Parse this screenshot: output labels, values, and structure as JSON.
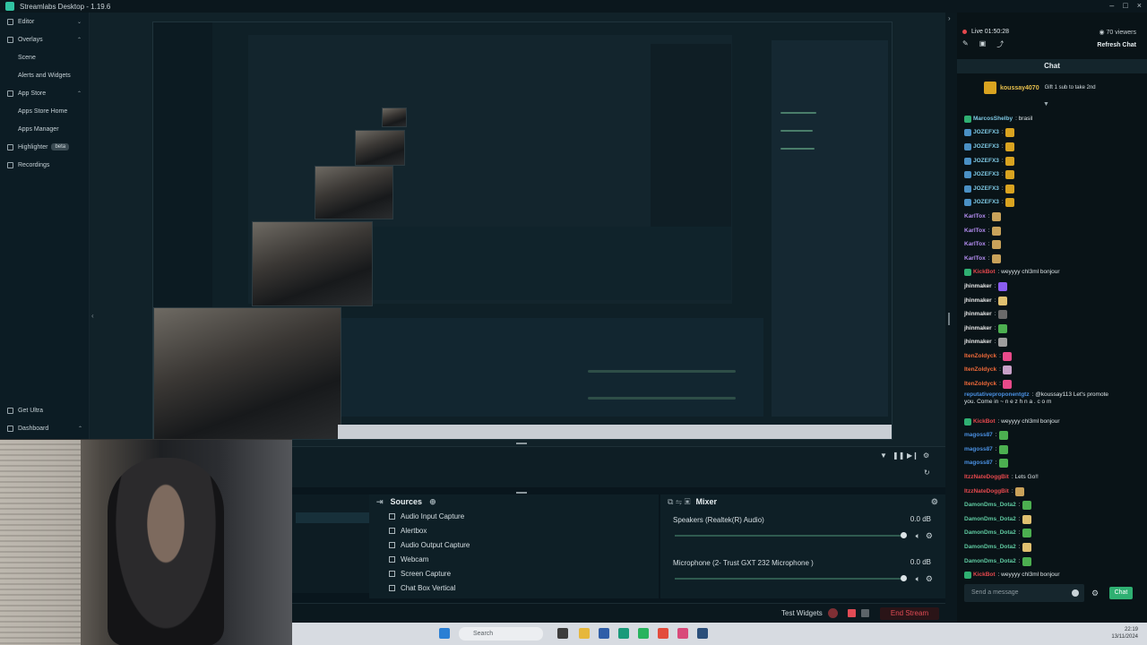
{
  "app": {
    "title": "Streamlabs Desktop - 1.19.6",
    "window_controls": [
      "–",
      "□",
      "×"
    ]
  },
  "sidebar": {
    "items": [
      {
        "label": "Editor",
        "icon": "editor-icon",
        "chevron": "⌄"
      },
      {
        "label": "Overlays",
        "icon": "overlays-icon",
        "chevron": "⌃"
      },
      {
        "label": "Scene",
        "sub": true
      },
      {
        "label": "Alerts and Widgets",
        "sub": true
      },
      {
        "label": "App Store",
        "icon": "store-icon",
        "chevron": "⌃"
      },
      {
        "label": "Apps Store Home",
        "sub": true
      },
      {
        "label": "Apps Manager",
        "sub": true
      },
      {
        "label": "Highlighter",
        "icon": "highlighter-icon",
        "badge": "beta"
      },
      {
        "label": "Recordings",
        "icon": "recordings-icon"
      }
    ],
    "bottom": [
      {
        "label": "Get Ultra",
        "icon": "ultra-icon"
      },
      {
        "label": "Dashboard",
        "icon": "dashboard-icon",
        "chevron": "⌃"
      }
    ]
  },
  "studio": {
    "sources_title": "Sources",
    "sources": [
      "Audio Input Capture",
      "Alertbox",
      "Audio Output Capture",
      "Webcam",
      "Screen Capture",
      "Chat Box Vertical"
    ],
    "mixer_title": "Mixer",
    "mixer": [
      {
        "name": "Speakers (Realtek(R) Audio)",
        "db": "0.0 dB",
        "level": 1.0
      },
      {
        "name": "Microphone (2- Trust GXT 232 Microphone )",
        "db": "0.0 dB",
        "level": 1.0
      }
    ],
    "test_widgets": "Test Widgets",
    "end_stream": "End Stream"
  },
  "chat": {
    "live": "Live 01:50:28",
    "viewers": "70 viewers",
    "refresh": "Refresh Chat",
    "header": "Chat",
    "sub_banner": {
      "user": "koussay4070",
      "text": "Gift 1 sub to take 2nd"
    },
    "messages": [
      {
        "name": "MarcosShelby",
        "color": "#7ec8e3",
        "text": ": brasil",
        "emblem": "#2fb072"
      },
      {
        "name": "JOZEFX3",
        "color": "#7ec8e3",
        "text": ":",
        "emblem": "#4a90c4",
        "emote": "#d9a320"
      },
      {
        "name": "JOZEFX3",
        "color": "#7ec8e3",
        "text": ":",
        "emblem": "#4a90c4",
        "emote": "#d9a320"
      },
      {
        "name": "JOZEFX3",
        "color": "#7ec8e3",
        "text": ":",
        "emblem": "#4a90c4",
        "emote": "#d9a320"
      },
      {
        "name": "JOZEFX3",
        "color": "#7ec8e3",
        "text": ":",
        "emblem": "#4a90c4",
        "emote": "#d9a320"
      },
      {
        "name": "JOZEFX3",
        "color": "#7ec8e3",
        "text": ":",
        "emblem": "#4a90c4",
        "emote": "#d9a320"
      },
      {
        "name": "JOZEFX3",
        "color": "#7ec8e3",
        "text": ":",
        "emblem": "#4a90c4",
        "emote": "#d9a320"
      },
      {
        "name": "KarlTox",
        "color": "#b38cf0",
        "text": ":",
        "emote": "#c9a25a"
      },
      {
        "name": "KarlTox",
        "color": "#b38cf0",
        "text": ":",
        "emote": "#c9a25a"
      },
      {
        "name": "KarlTox",
        "color": "#b38cf0",
        "text": ":",
        "emote": "#c9a25a"
      },
      {
        "name": "KarlTox",
        "color": "#b38cf0",
        "text": ":",
        "emote": "#c9a25a"
      },
      {
        "name": "KickBot",
        "color": "#e5484d",
        "text": ": weyyyy chl3ml bonjour",
        "emblem": "#2fb072"
      },
      {
        "name": "jhinmaker",
        "color": "#e6e6e6",
        "text": ":",
        "emote": "#8a5cf0"
      },
      {
        "name": "jhinmaker",
        "color": "#e6e6e6",
        "text": ":",
        "emote": "#e0c070"
      },
      {
        "name": "jhinmaker",
        "color": "#e6e6e6",
        "text": ":",
        "emote": "#6a6a6a"
      },
      {
        "name": "jhinmaker",
        "color": "#e6e6e6",
        "text": ":",
        "emote": "#4caf50"
      },
      {
        "name": "jhinmaker",
        "color": "#e6e6e6",
        "text": ":",
        "emote": "#9e9e9e"
      },
      {
        "name": "ItenZoldyck",
        "color": "#f06a3a",
        "text": ":",
        "emote": "#e84a8a"
      },
      {
        "name": "ItenZoldyck",
        "color": "#f06a3a",
        "text": ":",
        "emote": "#c8a0c8"
      },
      {
        "name": "ItenZoldyck",
        "color": "#f06a3a",
        "text": ":",
        "emote": "#e84a8a"
      },
      {
        "name": "reputativeproponentgtz",
        "color": "#4a90e2",
        "text": ": @koussay113 Let's promote you. Come in ~ n e z h n a . c o m",
        "tall": true
      },
      {
        "name": "KickBot",
        "color": "#e5484d",
        "text": ": weyyyy chl3ml bonjour",
        "emblem": "#2fb072"
      },
      {
        "name": "magoss87",
        "color": "#4a90e2",
        "text": ":",
        "emote": "#4caf50"
      },
      {
        "name": "magoss87",
        "color": "#4a90e2",
        "text": ":",
        "emote": "#4caf50"
      },
      {
        "name": "magoss87",
        "color": "#4a90e2",
        "text": ":",
        "emote": "#4caf50"
      },
      {
        "name": "ItzzNateDoggBit",
        "color": "#e5484d",
        "text": ": Lets Go!!",
        "emblem": null
      },
      {
        "name": "ItzzNateDoggBit",
        "color": "#e5484d",
        "text": ":",
        "emote": "#c9a25a"
      },
      {
        "name": "DamonDms_Dota2",
        "color": "#5fc9a0",
        "text": ":",
        "emote": "#4caf50"
      },
      {
        "name": "DamonDms_Dota2",
        "color": "#5fc9a0",
        "text": ":",
        "emote": "#e0c070"
      },
      {
        "name": "DamonDms_Dota2",
        "color": "#5fc9a0",
        "text": ":",
        "emote": "#4caf50"
      },
      {
        "name": "DamonDms_Dota2",
        "color": "#5fc9a0",
        "text": ":",
        "emote": "#e0c070"
      },
      {
        "name": "DamonDms_Dota2",
        "color": "#5fc9a0",
        "text": ":",
        "emote": "#4caf50"
      },
      {
        "name": "KickBot",
        "color": "#e5484d",
        "text": ": weyyyy chl3ml bonjour",
        "emblem": "#2fb072"
      }
    ],
    "input_placeholder": "Send a message",
    "send": "Chat"
  },
  "taskbar": {
    "search": "Search",
    "tray_time": "22:19",
    "tray_date": "13/11/2024"
  }
}
